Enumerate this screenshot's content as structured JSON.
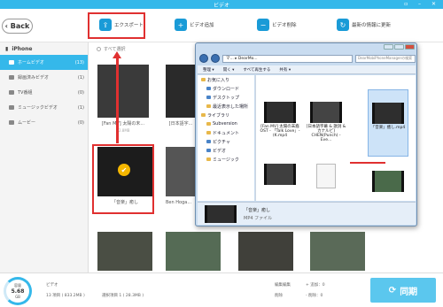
{
  "window": {
    "title": "ビデオ"
  },
  "toolbar": {
    "back_label": "Back",
    "export_label": "エクスポート",
    "add_label": "ビデオ追加",
    "delete_label": "ビデオ削除",
    "refresh_label": "最新の情報に更新"
  },
  "sidebar": {
    "device": "iPhone",
    "items": [
      {
        "label": "ホームビデオ",
        "count": "(13)"
      },
      {
        "label": "録画済みビデオ",
        "count": "(1)"
      },
      {
        "label": "TV番組",
        "count": "(0)"
      },
      {
        "label": "ミュージックビデオ",
        "count": "(1)"
      },
      {
        "label": "ムービー",
        "count": "(0)"
      }
    ]
  },
  "main": {
    "select_all": "すべて選択",
    "videos": [
      {
        "label": "[Fan MV] 太陽の末...",
        "size": "32.8MB"
      },
      {
        "label": "[日本語字..."
      },
      {
        "label": "「音楽」癒し"
      },
      {
        "label": "Ben Hoga..."
      }
    ]
  },
  "explorer": {
    "address": "マ... ▸ DearMo...",
    "search_placeholder": "DearMobiPhoneManagerの検索",
    "cmd": [
      "整理 ▾",
      "開く ▾",
      "すべて再生する",
      "共有 ▾"
    ],
    "nav": {
      "favorites": "お気に入り",
      "fav_items": [
        "ダウンロード",
        "デスクトップ",
        "最近表示した場所"
      ],
      "library": "ライブラリ",
      "lib_items": [
        "Subversion",
        "ドキュメント",
        "ピクチャ",
        "ビデオ",
        "ミュージック"
      ]
    },
    "files": [
      "[Fan MV] 太陽の末裔 OST - 「Talk Love」- (K.mp4",
      "[日本語字幕 & 歌詞 & カナルビ] CHEN(Punch) - Eve...",
      "「音楽」癒し.mp4"
    ],
    "details": {
      "name": "「音楽」癒し",
      "type": "MP4 ファイル"
    }
  },
  "status": {
    "capacity": "容量",
    "capacity_value": "5.68",
    "capacity_unit": "GB",
    "category": "ビデオ",
    "total": "13 項目 ( 833.2MB )",
    "selected": "選択項目 1 ( 28.3MB )",
    "legend_edit": "編集編集",
    "legend_delete": "削除",
    "add": "+ 追加：0",
    "remove": "- 削除：0",
    "sync_label": "同期"
  },
  "colors": {
    "accent": "#35b8ea",
    "highlight": "#e03030",
    "sync": "#5bc7ee"
  }
}
